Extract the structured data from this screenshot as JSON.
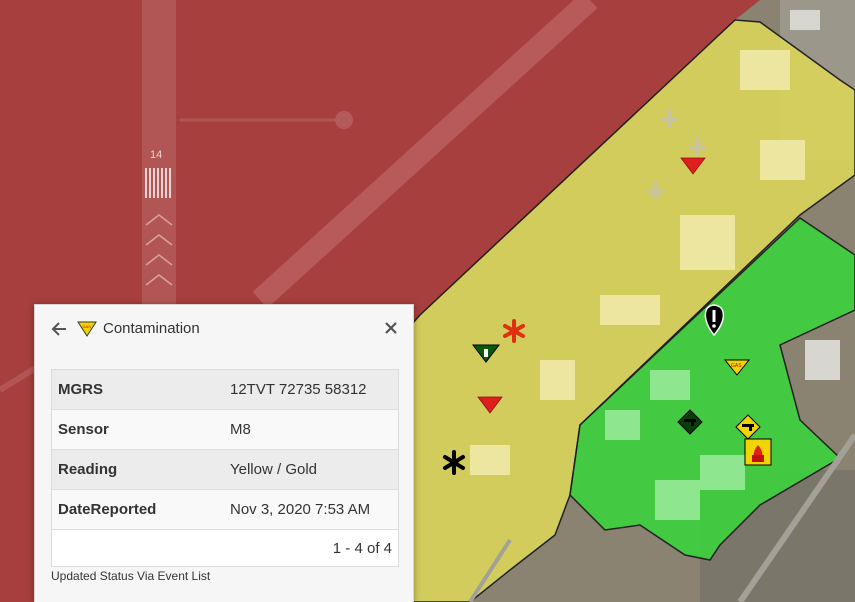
{
  "map": {
    "runway_marking": "14",
    "zone_colors": {
      "red": "#b33a3a",
      "yellow": "#e7e36a",
      "green": "#3fd13f"
    },
    "markers": [
      {
        "icon": "red-triangle-marker-icon"
      },
      {
        "icon": "red-triangle-marker-icon"
      },
      {
        "icon": "green-triangle-marker-icon"
      },
      {
        "icon": "medical-star-red-icon"
      },
      {
        "icon": "medical-star-black-icon"
      },
      {
        "icon": "exclamation-pin-icon"
      },
      {
        "icon": "gas-triangle-icon"
      },
      {
        "icon": "gun-diamond-icon"
      },
      {
        "icon": "gun-diamond-yellow-icon"
      },
      {
        "icon": "fire-square-icon"
      }
    ]
  },
  "popup": {
    "title": "Contamination",
    "back_icon": "arrow-left-icon",
    "close_icon": "close-icon",
    "header_icon": "gas-triangle-icon",
    "rows": [
      {
        "key": "MGRS",
        "value": "12TVT 72735 58312"
      },
      {
        "key": "Sensor",
        "value": "M8"
      },
      {
        "key": "Reading",
        "value": "Yellow / Gold"
      },
      {
        "key": "DateReported",
        "value": "Nov 3, 2020 7:53 AM"
      }
    ],
    "pager": "1 - 4 of 4",
    "status": "Updated Status Via Event List"
  }
}
